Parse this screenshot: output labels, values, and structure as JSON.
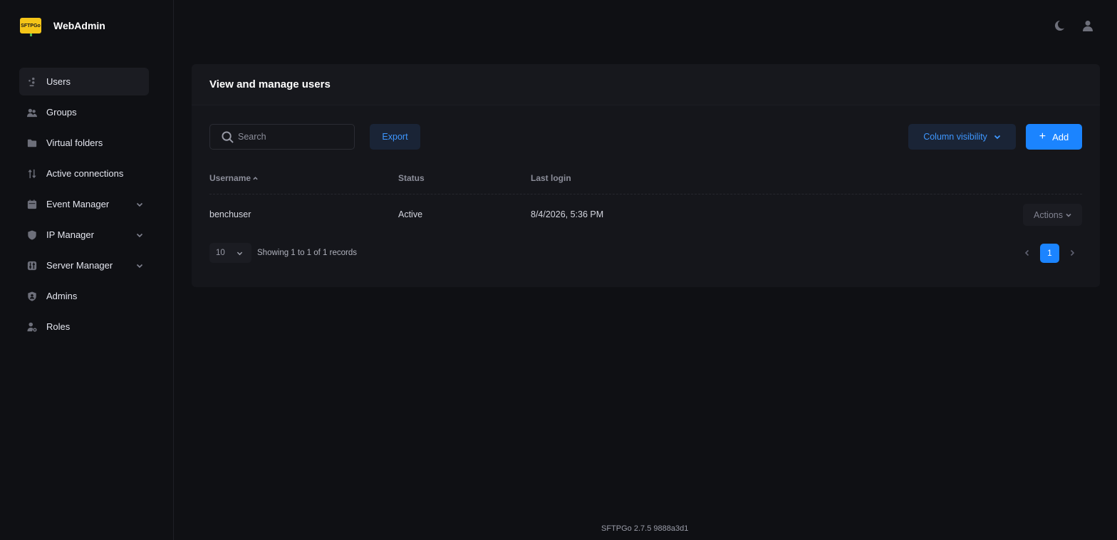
{
  "brand": {
    "logo_text": "SFTPGo",
    "name": "WebAdmin"
  },
  "sidebar": {
    "items": [
      {
        "label": "Users",
        "icon": "users-icon",
        "active": true
      },
      {
        "label": "Groups",
        "icon": "groups-icon"
      },
      {
        "label": "Virtual folders",
        "icon": "folder-icon"
      },
      {
        "label": "Active connections",
        "icon": "arrows-updown-icon"
      },
      {
        "label": "Event Manager",
        "icon": "calendar-icon",
        "expandable": true
      },
      {
        "label": "IP Manager",
        "icon": "shield-icon",
        "expandable": true
      },
      {
        "label": "Server Manager",
        "icon": "sliders-icon",
        "expandable": true
      },
      {
        "label": "Admins",
        "icon": "shield-user-icon"
      },
      {
        "label": "Roles",
        "icon": "user-gear-icon"
      }
    ]
  },
  "topbar": {
    "theme_icon": "moon-icon",
    "user_icon": "user-icon"
  },
  "main": {
    "title": "View and manage users",
    "search_placeholder": "Search",
    "export_label": "Export",
    "column_visibility_label": "Column visibility",
    "add_label": "Add",
    "table": {
      "columns": [
        "Username",
        "Status",
        "Last login"
      ],
      "rows": [
        {
          "username": "benchuser",
          "status": "Active",
          "last_login": "8/4/2026, 5:36 PM",
          "actions_label": "Actions"
        }
      ]
    },
    "pagination": {
      "page_size": "10",
      "showing": "Showing 1 to 1 of 1 records",
      "current_page": "1"
    }
  },
  "footer": {
    "version": "SFTPGo 2.7.5 9888a3d1"
  },
  "colors": {
    "accent": "#1b84ff",
    "background": "#0f1014",
    "card": "#15161b"
  }
}
